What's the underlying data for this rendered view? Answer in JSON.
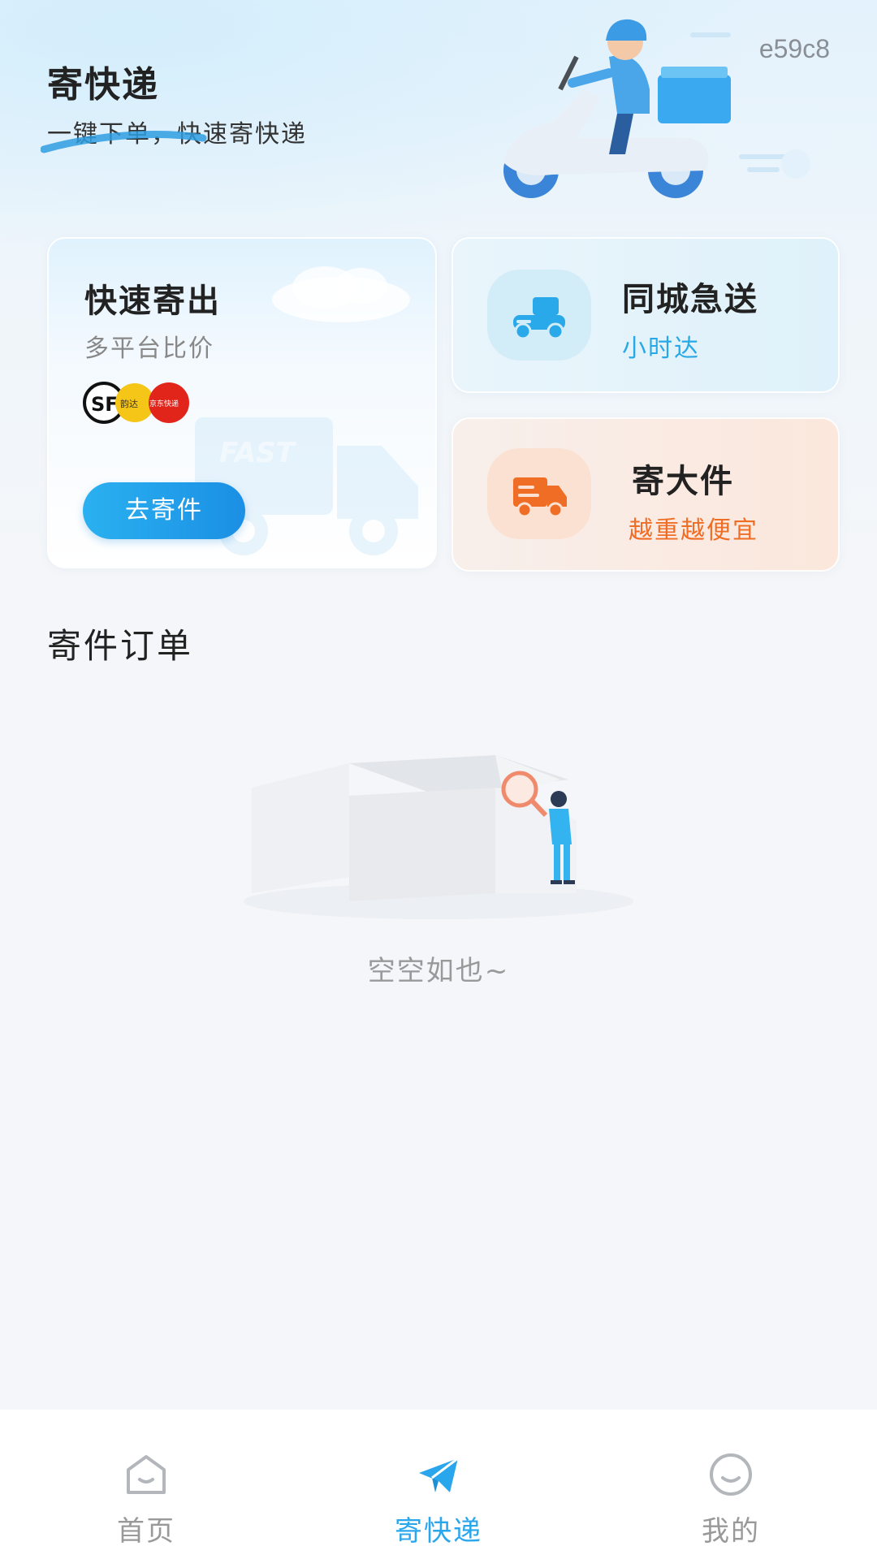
{
  "header": {
    "title": "寄快递",
    "subtitle": "一键下单，快速寄快递",
    "watermark": "e59c8"
  },
  "cards": {
    "express": {
      "title": "快速寄出",
      "subtitle": "多平台比价",
      "button_label": "去寄件",
      "carrier_logos": [
        "SF",
        "韵达",
        "京东快递"
      ],
      "background_text": "FAST"
    },
    "same_city": {
      "title": "同城急送",
      "subtitle": "小时达",
      "accent": "#27a9e7"
    },
    "bulky": {
      "title": "寄大件",
      "subtitle": "越重越便宜",
      "accent": "#f06d25"
    }
  },
  "orders": {
    "section_title": "寄件订单",
    "empty_text": "空空如也~"
  },
  "tabbar": {
    "items": [
      {
        "label": "首页",
        "icon": "home-icon",
        "active": false
      },
      {
        "label": "寄快递",
        "icon": "paper-plane-icon",
        "active": true
      },
      {
        "label": "我的",
        "icon": "smiley-icon",
        "active": false
      }
    ],
    "active_color": "#2aa6ec",
    "inactive_color": "#999999"
  }
}
